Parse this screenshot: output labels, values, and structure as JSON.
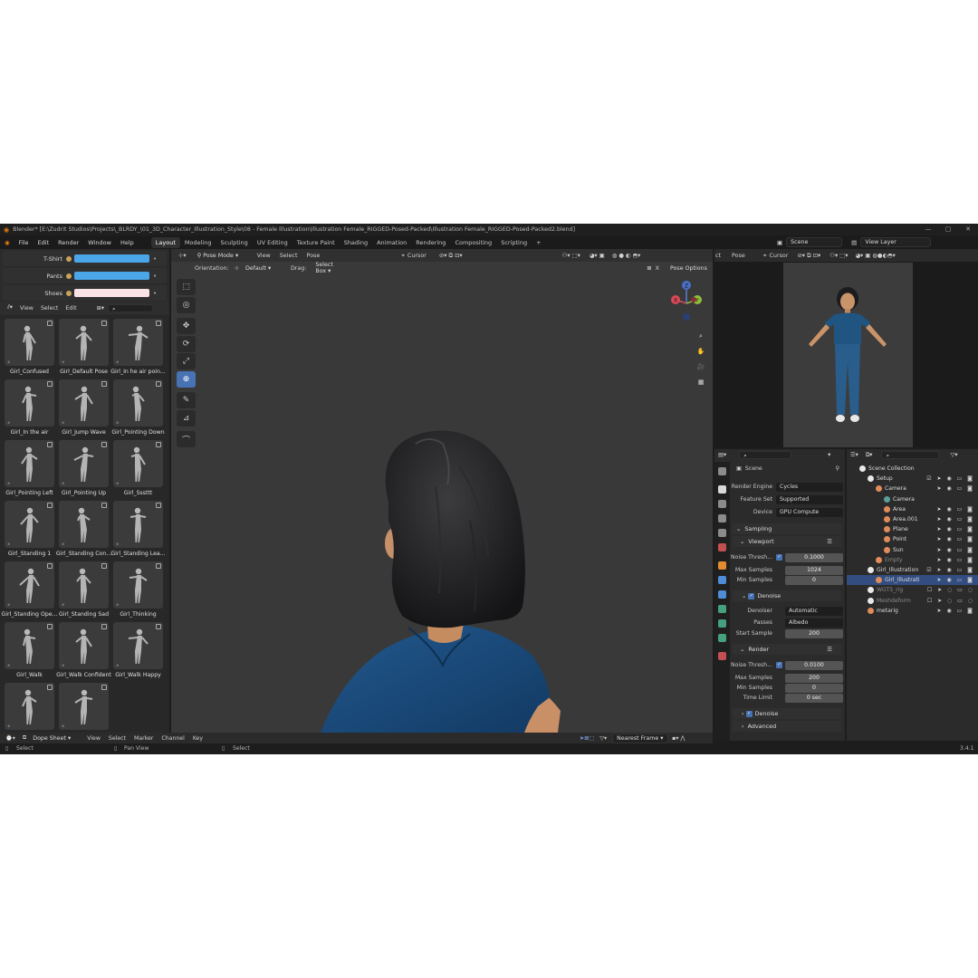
{
  "title": "Blender* [E:\\Zudrit Studios\\Projects\\_BLRDY_\\01_3D_Character_Illustration_Style\\08 - Female Illustration\\Illustration Female_RIGGED-Posed-Packed\\Illustration Female_RIGGED-Posed-Packed2.blend]",
  "menu": [
    "File",
    "Edit",
    "Render",
    "Window",
    "Help"
  ],
  "workspaces": [
    "Layout",
    "Modeling",
    "Sculpting",
    "UV Editing",
    "Texture Paint",
    "Shading",
    "Animation",
    "Rendering",
    "Compositing",
    "Scripting",
    "+"
  ],
  "scene_field": "Scene",
  "view_layer_field": "View Layer",
  "colors": {
    "tshirt": "#4aa6e8",
    "pants": "#4aa6e8",
    "shoes": "#fbe2e6",
    "accent": "#4772b3"
  },
  "props": [
    {
      "label": "T-Shirt",
      "color": "#4aa6e8"
    },
    {
      "label": "Pants",
      "color": "#4aa6e8"
    },
    {
      "label": "Shoes",
      "color": "#fbe2e6"
    }
  ],
  "asset_menu": [
    "View",
    "Select",
    "Edit"
  ],
  "poses": [
    "Girl_Confused",
    "Girl_Default Pose",
    "Girl_In he air poin...",
    "Girl_In the air",
    "Girl_Jump Wave",
    "Girl_Pointing Down",
    "Girl_Pointing Left",
    "Girl_Pointing Up",
    "Girl_Sssttt",
    "Girl_Standing 1",
    "Girl_Standing Con...",
    "Girl_Standing Lea...",
    "Girl_Standing Ope...",
    "Girl_Standing Sad",
    "Girl_Thinking",
    "Girl_Walk",
    "Girl_Walk Confident",
    "Girl_Walk Happy",
    "",
    ""
  ],
  "viewport": {
    "mode": "Pose Mode",
    "menu": [
      "View",
      "Select",
      "Pose"
    ],
    "orientation_label": "Orientation:",
    "orientation": "Default",
    "drag_label": "Drag:",
    "drag": "Select Box",
    "pivot": "Cursor",
    "pose_options": "Pose Options",
    "x_label": "X"
  },
  "preview": {
    "head_left": "ct",
    "head_menu": "Pose",
    "pivot": "Cursor"
  },
  "dopesheet": {
    "mode": "Dope Sheet",
    "menu": [
      "View",
      "Select",
      "Marker",
      "Channel",
      "Key"
    ],
    "snap": "Nearest Frame"
  },
  "status": {
    "left": "Select",
    "mid": "Pan View",
    "right": "Select",
    "version": "3.4.1"
  },
  "properties": {
    "scene": "Scene",
    "render_engine_label": "Render Engine",
    "render_engine": "Cycles",
    "feature_set_label": "Feature Set",
    "feature_set": "Supported",
    "device_label": "Device",
    "device": "GPU Compute",
    "sampling": "Sampling",
    "viewport": "Viewport",
    "noise_label": "Noise Thresh...",
    "vp_noise": "0.1000",
    "max_samples_label": "Max Samples",
    "vp_max": "1024",
    "min_samples_label": "Min Samples",
    "vp_min": "0",
    "denoise": "Denoise",
    "denoiser_label": "Denoiser",
    "denoiser": "Automatic",
    "passes_label": "Passes",
    "passes": "Albedo",
    "start_sample_label": "Start Sample",
    "start_sample": "200",
    "render": "Render",
    "r_noise": "0.0100",
    "r_max": "200",
    "r_min": "0",
    "time_limit_label": "Time Limit",
    "time_limit": "0 sec",
    "advanced": "Advanced"
  },
  "outliner": [
    {
      "name": "Scene Collection",
      "indent": 0,
      "icon": "#e8e8e8",
      "flags": ""
    },
    {
      "name": "Setup",
      "indent": 1,
      "icon": "#e8e8e8",
      "flags": "☑ ➤ ◉ ▭ ◙"
    },
    {
      "name": "Camera",
      "indent": 2,
      "icon": "#e08c5a",
      "flags": "➤ ◉ ▭ ◙"
    },
    {
      "name": "Camera",
      "indent": 3,
      "icon": "#5aa09a",
      "flags": ""
    },
    {
      "name": "Area",
      "indent": 3,
      "icon": "#e08c5a",
      "flags": "➤ ◉ ▭ ◙"
    },
    {
      "name": "Area.001",
      "indent": 3,
      "icon": "#e08c5a",
      "flags": "➤ ◉ ▭ ◙"
    },
    {
      "name": "Plane",
      "indent": 3,
      "icon": "#e08c5a",
      "flags": "➤ ◉ ▭ ◙"
    },
    {
      "name": "Point",
      "indent": 3,
      "icon": "#e08c5a",
      "flags": "➤ ◉ ▭ ◙"
    },
    {
      "name": "Sun",
      "indent": 3,
      "icon": "#e08c5a",
      "flags": "➤ ◉ ▭ ◙"
    },
    {
      "name": "Empty",
      "indent": 2,
      "icon": "#e08c5a",
      "flags": "➤ ◉ ▭ ◙"
    },
    {
      "name": "Girl_Illustration",
      "indent": 1,
      "icon": "#e8e8e8",
      "flags": "☑ ➤ ◉ ▭ ◙"
    },
    {
      "name": "Girl_Illustrati",
      "indent": 2,
      "icon": "#e08c5a",
      "flags": "➤ ◉ ▭ ◙",
      "selected": true
    },
    {
      "name": "WGTS_rig",
      "indent": 1,
      "icon": "#e8e8e8",
      "flags": "☐ ➤ ◌ ▭ ◌"
    },
    {
      "name": "Meshdeform",
      "indent": 1,
      "icon": "#e8e8e8",
      "flags": "☐ ➤ ◌ ▭ ◌"
    },
    {
      "name": "metarig",
      "indent": 1,
      "icon": "#e08c5a",
      "flags": "➤ ◉ ▭ ◙"
    }
  ]
}
